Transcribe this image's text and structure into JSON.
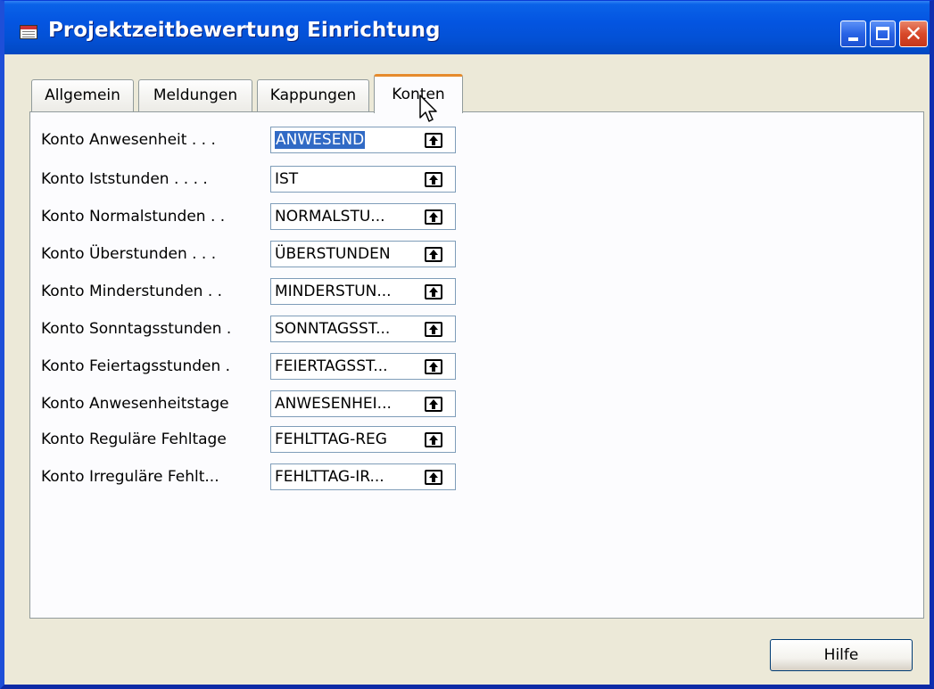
{
  "window": {
    "title": "Projektzeitbewertung Einrichtung"
  },
  "tabs": [
    {
      "label": "Allgemein",
      "active": false
    },
    {
      "label": "Meldungen",
      "active": false
    },
    {
      "label": "Kappungen",
      "active": false
    },
    {
      "label": "Konten",
      "active": true
    }
  ],
  "fields": [
    {
      "label": "Konto Anwesenheit . . .",
      "value": "ANWESEND",
      "selected": true
    },
    {
      "label": "Konto Iststunden . . . .",
      "value": "IST"
    },
    {
      "label": "Konto Normalstunden . .",
      "value": "NORMALSTU..."
    },
    {
      "label": "Konto Überstunden . . .",
      "value": "ÜBERSTUNDEN"
    },
    {
      "label": "Konto Minderstunden . .",
      "value": "MINDERSTUN..."
    },
    {
      "label": "Konto Sonntagsstunden .",
      "value": "SONNTAGSST..."
    },
    {
      "label": "Konto Feiertagsstunden .",
      "value": "FEIERTAGSST..."
    },
    {
      "label": "Konto Anwesenheitstage",
      "value": "ANWESENHEI..."
    },
    {
      "label": "Konto Reguläre Fehltage",
      "value": "FEHLTTAG-REG"
    },
    {
      "label": "Konto Irreguläre Fehlt...",
      "value": "FEHLTTAG-IR..."
    }
  ],
  "buttons": {
    "help_label": "Hilfe",
    "close_glyph": "✕"
  },
  "icons": {
    "app": "form-icon",
    "lookup": "lookup-arrow-icon"
  },
  "colors": {
    "titlebar": "#0455e1",
    "active_tab_accent": "#e68b2c",
    "selection": "#316ac5"
  }
}
